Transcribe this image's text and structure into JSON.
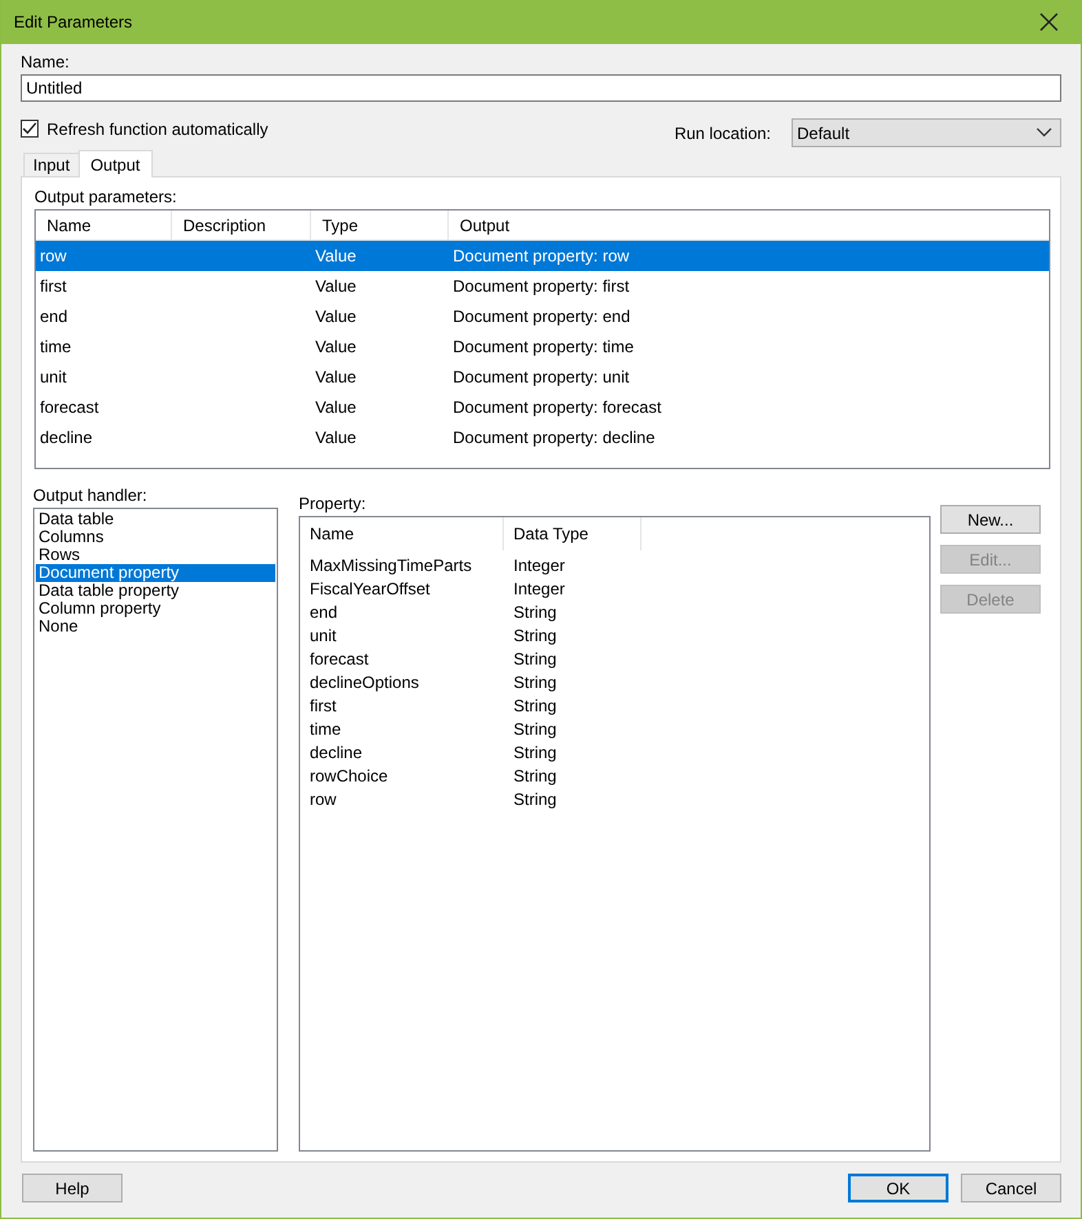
{
  "window": {
    "title": "Edit Parameters"
  },
  "name_field": {
    "label": "Name:",
    "value": "Untitled"
  },
  "refresh_checkbox": {
    "label": "Refresh function automatically",
    "checked": true
  },
  "run_location": {
    "label": "Run location:",
    "value": "Default"
  },
  "tabs": [
    {
      "label": "Input",
      "selected": false
    },
    {
      "label": "Output",
      "selected": true
    }
  ],
  "output_parameters": {
    "label": "Output parameters:",
    "columns": [
      "Name",
      "Description",
      "Type",
      "Output"
    ],
    "rows": [
      {
        "cells": [
          "row",
          "",
          "Value",
          "Document property: row"
        ],
        "selected": true
      },
      {
        "cells": [
          "first",
          "",
          "Value",
          "Document property: first"
        ],
        "selected": false
      },
      {
        "cells": [
          "end",
          "",
          "Value",
          "Document property: end"
        ],
        "selected": false
      },
      {
        "cells": [
          "time",
          "",
          "Value",
          "Document property: time"
        ],
        "selected": false
      },
      {
        "cells": [
          "unit",
          "",
          "Value",
          "Document property: unit"
        ],
        "selected": false
      },
      {
        "cells": [
          "forecast",
          "",
          "Value",
          "Document property: forecast"
        ],
        "selected": false
      },
      {
        "cells": [
          "decline",
          "",
          "Value",
          "Document property: decline"
        ],
        "selected": false
      }
    ]
  },
  "output_handler": {
    "label": "Output handler:",
    "items": [
      {
        "label": "Data table",
        "selected": false
      },
      {
        "label": "Columns",
        "selected": false
      },
      {
        "label": "Rows",
        "selected": false
      },
      {
        "label": "Document property",
        "selected": true
      },
      {
        "label": "Data table property",
        "selected": false
      },
      {
        "label": "Column property",
        "selected": false
      },
      {
        "label": "None",
        "selected": false
      }
    ]
  },
  "property": {
    "label": "Property:",
    "columns": [
      "Name",
      "Data Type"
    ],
    "rows": [
      [
        "MaxMissingTimeParts",
        "Integer"
      ],
      [
        "FiscalYearOffset",
        "Integer"
      ],
      [
        "end",
        "String"
      ],
      [
        "unit",
        "String"
      ],
      [
        "forecast",
        "String"
      ],
      [
        "declineOptions",
        "String"
      ],
      [
        "first",
        "String"
      ],
      [
        "time",
        "String"
      ],
      [
        "decline",
        "String"
      ],
      [
        "rowChoice",
        "String"
      ],
      [
        "row",
        "String"
      ]
    ]
  },
  "side_buttons": [
    {
      "label": "New...",
      "disabled": false
    },
    {
      "label": "Edit...",
      "disabled": true
    },
    {
      "label": "Delete",
      "disabled": true
    }
  ],
  "footer_buttons": [
    {
      "label": "Help",
      "default": false
    },
    {
      "label": "OK",
      "default": true
    },
    {
      "label": "Cancel",
      "default": false
    }
  ]
}
